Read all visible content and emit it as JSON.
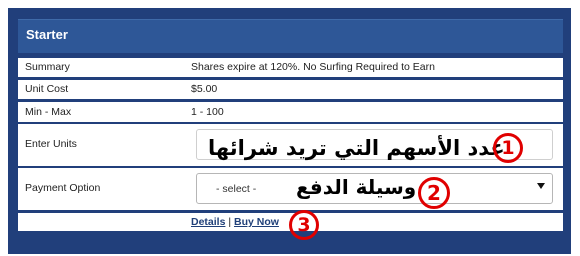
{
  "panel": {
    "title": "Starter"
  },
  "rows": {
    "summary": {
      "label": "Summary",
      "value": "Shares expire at 120%. No Surfing Required to Earn"
    },
    "unit_cost": {
      "label": "Unit Cost",
      "value": "$5.00"
    },
    "min_max": {
      "label": "Min - Max",
      "value": "1 - 100"
    },
    "enter_units": {
      "label": "Enter Units",
      "value": ""
    },
    "payment_option": {
      "label": "Payment Option",
      "selected": "- select -"
    }
  },
  "links": {
    "details": "Details",
    "separator": "|",
    "buy_now": "Buy Now"
  },
  "annotations": {
    "units_note": "عدد الأسهم التي تريد شرائها",
    "payment_note": "وسيلة الدفع",
    "marker_1": "1",
    "marker_2": "2",
    "marker_3": "3"
  },
  "colors": {
    "panel_bg": "#213f7b",
    "header_bg": "#2e5797",
    "link": "#1f3f78",
    "annotation_red": "#e00000"
  }
}
